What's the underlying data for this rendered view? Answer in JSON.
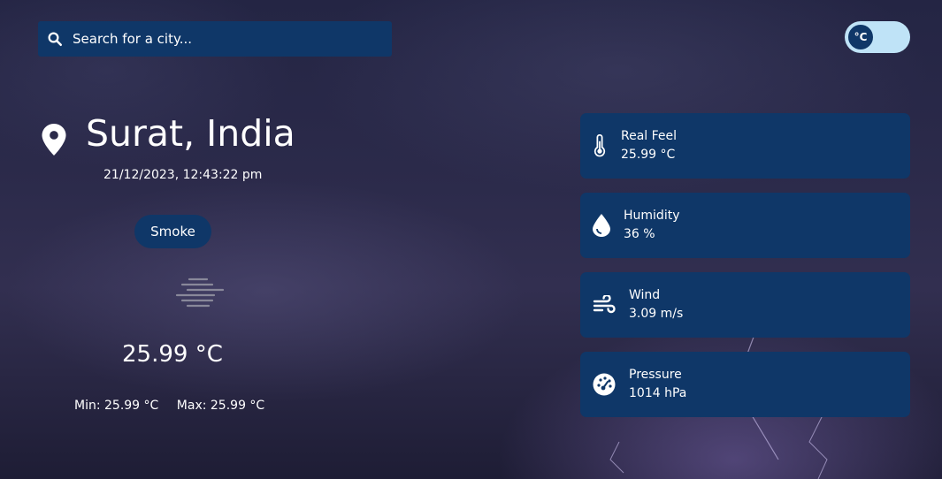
{
  "search": {
    "placeholder": "Search for a city..."
  },
  "unit_toggle": {
    "label": "°C"
  },
  "location": {
    "city": "Surat, India"
  },
  "datetime": "21/12/2023, 12:43:22 pm",
  "condition": "Smoke",
  "temperature": "25.99 °C",
  "min": "Min: 25.99 °C",
  "max": "Max: 25.99 °C",
  "details": [
    {
      "label": "Real Feel",
      "value": "25.99 °C",
      "icon": "thermometer-icon"
    },
    {
      "label": "Humidity",
      "value": "36 %",
      "icon": "droplet-icon"
    },
    {
      "label": "Wind",
      "value": "3.09 m/s",
      "icon": "wind-icon"
    },
    {
      "label": "Pressure",
      "value": "1014 hPa",
      "icon": "gauge-icon"
    }
  ],
  "colors": {
    "panel": "#0f3768",
    "toggle_track": "#bfe3f7",
    "text": "#ffffff"
  }
}
